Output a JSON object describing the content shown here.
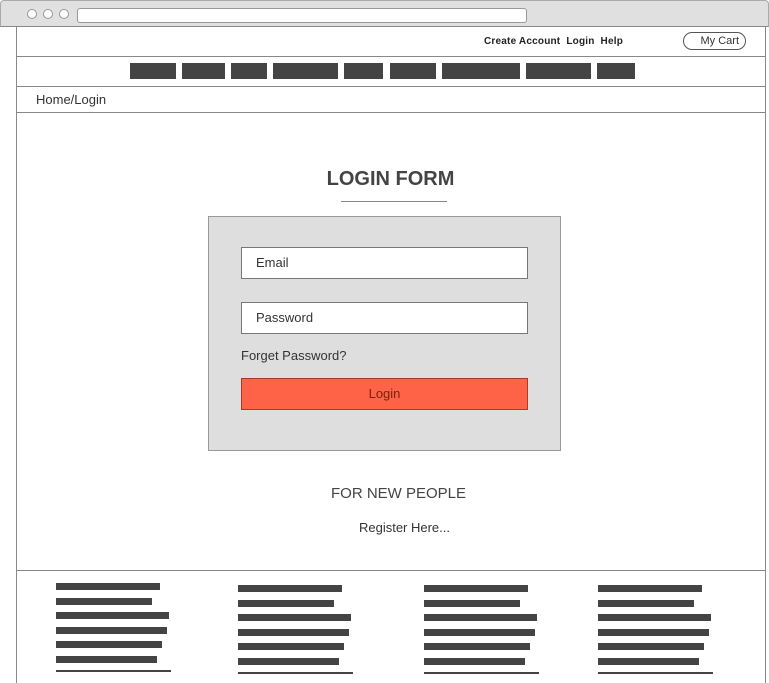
{
  "top_links": {
    "create_account": "Create Account",
    "login": "Login",
    "help": "Help"
  },
  "cart": {
    "label": "My Cart"
  },
  "breadcrumb": {
    "text": "Home/Login"
  },
  "login_form": {
    "title": "LOGIN FORM",
    "email_placeholder": "Email",
    "password_placeholder": "Password",
    "forget_password": "Forget Password?",
    "login_button": "Login"
  },
  "new_people": {
    "heading": "FOR NEW PEOPLE",
    "register_link": "Register Here..."
  },
  "colors": {
    "accent": "#ff6347",
    "placeholder_block": "#444444",
    "panel": "#dedede"
  }
}
